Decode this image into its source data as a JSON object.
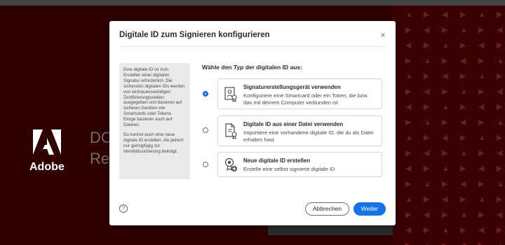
{
  "background": {
    "app_title_partial": "DC\nRe",
    "brand_word": "Adobe"
  },
  "dialog": {
    "title": "Digitale ID zum Signieren konfigurieren",
    "close_glyph": "×",
    "info_paragraph_1": "Eine digitale ID ist zum Erstellen einer digitalen Signatur erforderlich. Die sichersten digitalen IDs werden von vertrauenswürdigen Zertifizierungsstellen ausgegeben und basieren auf sicheren Geräten wie Smartcards oder Tokens. Einige basieren auch auf Dateien.",
    "info_paragraph_2": "Du kannst auch eine neue digitale ID erstellen, die jedoch nur geringfügig zur Identitätssicherung beiträgt.",
    "question": "Wähle den Typ der digitalen ID aus:",
    "options": [
      {
        "title": "Signaturerstellungsgerät verwenden",
        "description": "Konfiguriere eine Smartcard oder ein Token, die bzw. das mit deinem Computer verbunden ist",
        "icon": "device-certificate-icon",
        "selected": true
      },
      {
        "title": "Digitale ID aus einer Datei verwenden",
        "description": "Importiere eine vorhandene digitale ID, die du als Datei erhalten hast",
        "icon": "file-certificate-icon",
        "selected": false
      },
      {
        "title": "Neue digitale ID erstellen",
        "description": "Erstelle eine selbst signierte digitale ID",
        "icon": "new-id-icon",
        "selected": false
      }
    ],
    "help_glyph": "?",
    "cancel_label": "Abbrechen",
    "next_label": "Weiter"
  },
  "colors": {
    "accent": "#1473e6",
    "backdrop": "#2f0101"
  }
}
